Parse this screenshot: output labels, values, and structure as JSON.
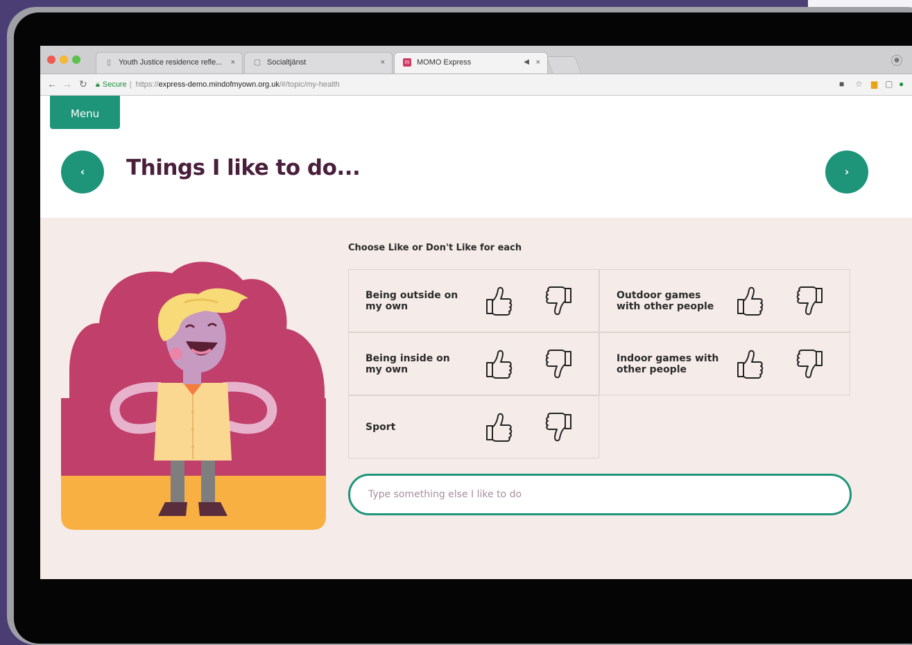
{
  "browser": {
    "tabs": [
      {
        "label": "Youth Justice residence refle...",
        "icon": "page-icon",
        "active": false
      },
      {
        "label": "Socialtjänst",
        "icon": "document-icon",
        "active": false
      },
      {
        "label": "MOMO Express",
        "icon": "momo-favicon",
        "active": true
      }
    ],
    "address": {
      "secure_label": "Secure",
      "scheme": "https://",
      "host": "express-demo.mindofmyown.org.uk",
      "path": "/#/topic/my-health"
    }
  },
  "page": {
    "menu_label": "Menu",
    "title": "Things I like to do...",
    "prev_label": "‹",
    "next_label": "›",
    "instruction": "Choose Like or Don't Like for each",
    "activities": [
      {
        "label": "Being outside on my own"
      },
      {
        "label": "Outdoor games with other people"
      },
      {
        "label": "Being inside on my own"
      },
      {
        "label": "Indoor games with other people"
      },
      {
        "label": "Sport"
      }
    ],
    "other_input": {
      "placeholder": "Type something else I like to do",
      "value": ""
    }
  },
  "colors": {
    "accent": "#1e9478",
    "title": "#4a1f3b",
    "content_bg": "#f5ece9",
    "illustration_backdrop": "#c13f6b",
    "illustration_floor": "#f9b043"
  }
}
